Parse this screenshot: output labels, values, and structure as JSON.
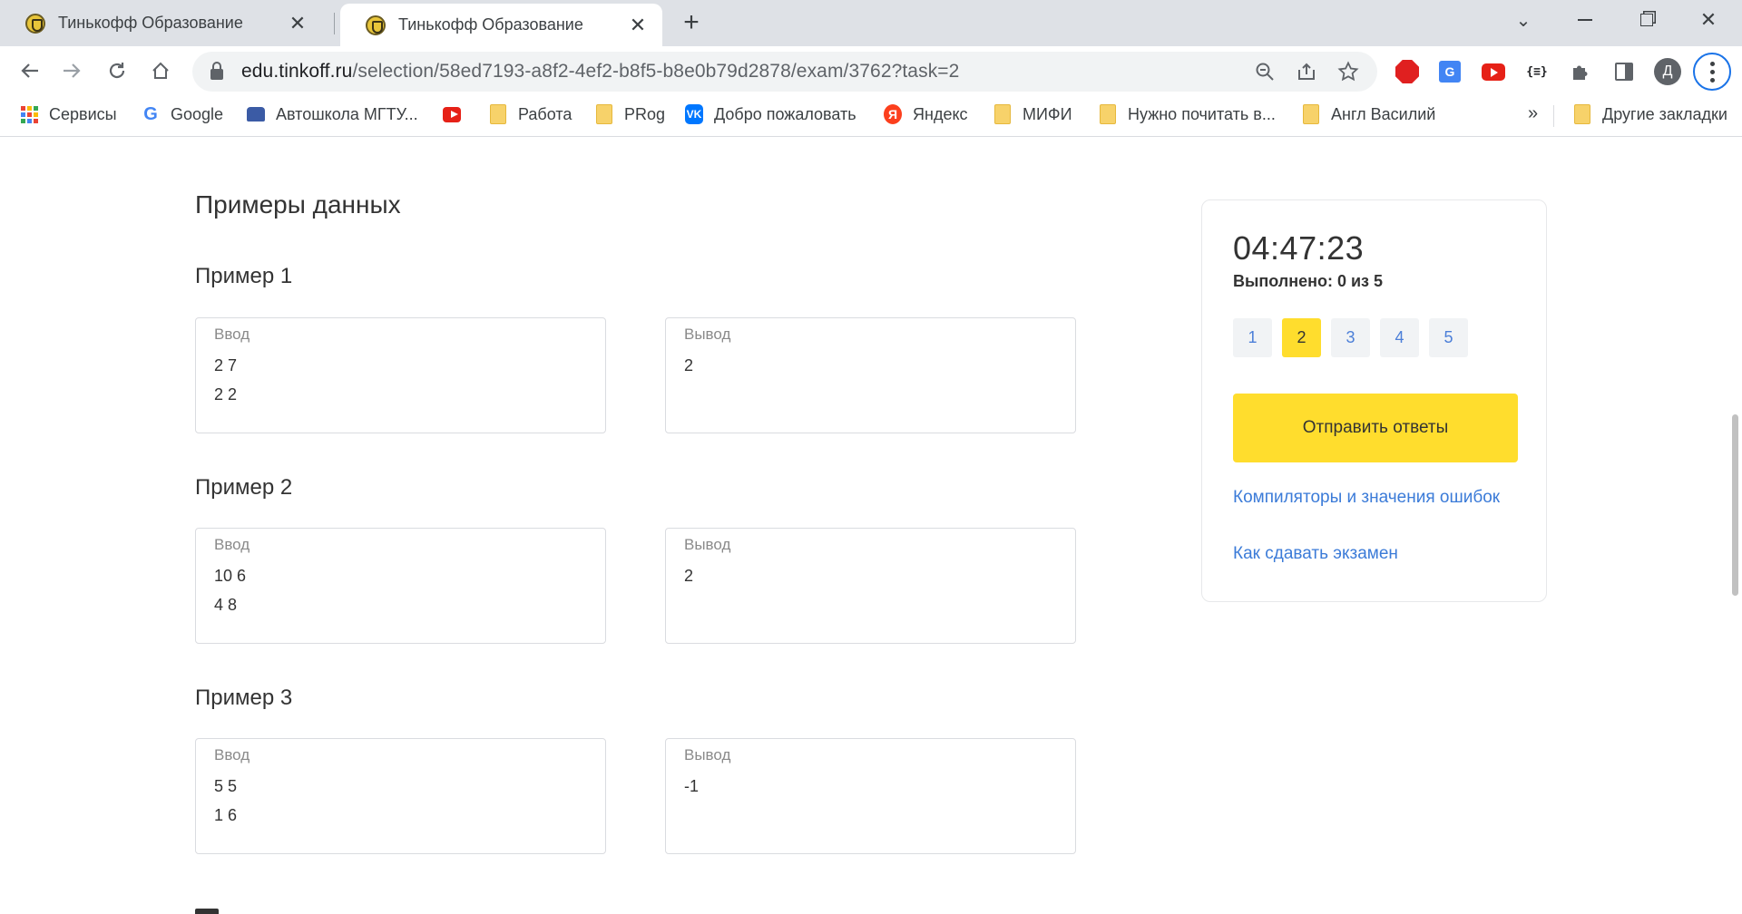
{
  "browser": {
    "tabs": [
      {
        "title": "Тинькофф Образование",
        "active": false
      },
      {
        "title": "Тинькофф Образование",
        "active": true
      }
    ],
    "url_host": "edu.tinkoff.ru",
    "url_path": "/selection/58ed7193-a8f2-4ef2-b8f5-b8e0b79d2878/exam/3762?task=2",
    "profile_initial": "Д",
    "bookmarks": [
      {
        "label": "Сервисы",
        "icon": "apps-icon"
      },
      {
        "label": "Google",
        "icon": "google-icon"
      },
      {
        "label": "Автошкола МГТУ...",
        "icon": "car-icon"
      },
      {
        "label": "",
        "icon": "youtube-icon"
      },
      {
        "label": "Работа",
        "icon": "folder-icon"
      },
      {
        "label": "PRog",
        "icon": "folder-icon"
      },
      {
        "label": "Добро пожаловать",
        "icon": "vk-icon"
      },
      {
        "label": "Яндекс",
        "icon": "yandex-icon"
      },
      {
        "label": "МИФИ",
        "icon": "folder-icon"
      },
      {
        "label": "Нужно почитать в...",
        "icon": "folder-icon"
      },
      {
        "label": "Англ Василий",
        "icon": "folder-icon"
      }
    ],
    "bookmarks_more": "»",
    "other_bookmarks": "Другие закладки",
    "ext_translate": "G",
    "ext_json": "{≡}",
    "ya_letter": "Я",
    "vk_letter": "VK",
    "google_letter": "G"
  },
  "content": {
    "section_title": "Примеры данных",
    "examples": [
      {
        "title": "Пример 1",
        "input_label": "Ввод",
        "input": [
          "2 7",
          "2 2"
        ],
        "output_label": "Вывод",
        "output": [
          "2"
        ]
      },
      {
        "title": "Пример 2",
        "input_label": "Ввод",
        "input": [
          "10 6",
          "4 8"
        ],
        "output_label": "Вывод",
        "output": [
          "2"
        ]
      },
      {
        "title": "Пример 3",
        "input_label": "Ввод",
        "input": [
          "5 5",
          "1 6"
        ],
        "output_label": "Вывод",
        "output": [
          "-1"
        ]
      }
    ]
  },
  "sidebar": {
    "timer": "04:47:23",
    "progress": "Выполнено: 0 из 5",
    "tasks": [
      "1",
      "2",
      "3",
      "4",
      "5"
    ],
    "current_task": "2",
    "submit_label": "Отправить ответы",
    "link_compilers": "Компиляторы и значения ошибок",
    "link_howto": "Как сдавать экзамен"
  },
  "colors": {
    "accent_yellow": "#ffdd2d",
    "link_blue": "#3b7bd8",
    "tab_strip": "#dee1e6"
  }
}
